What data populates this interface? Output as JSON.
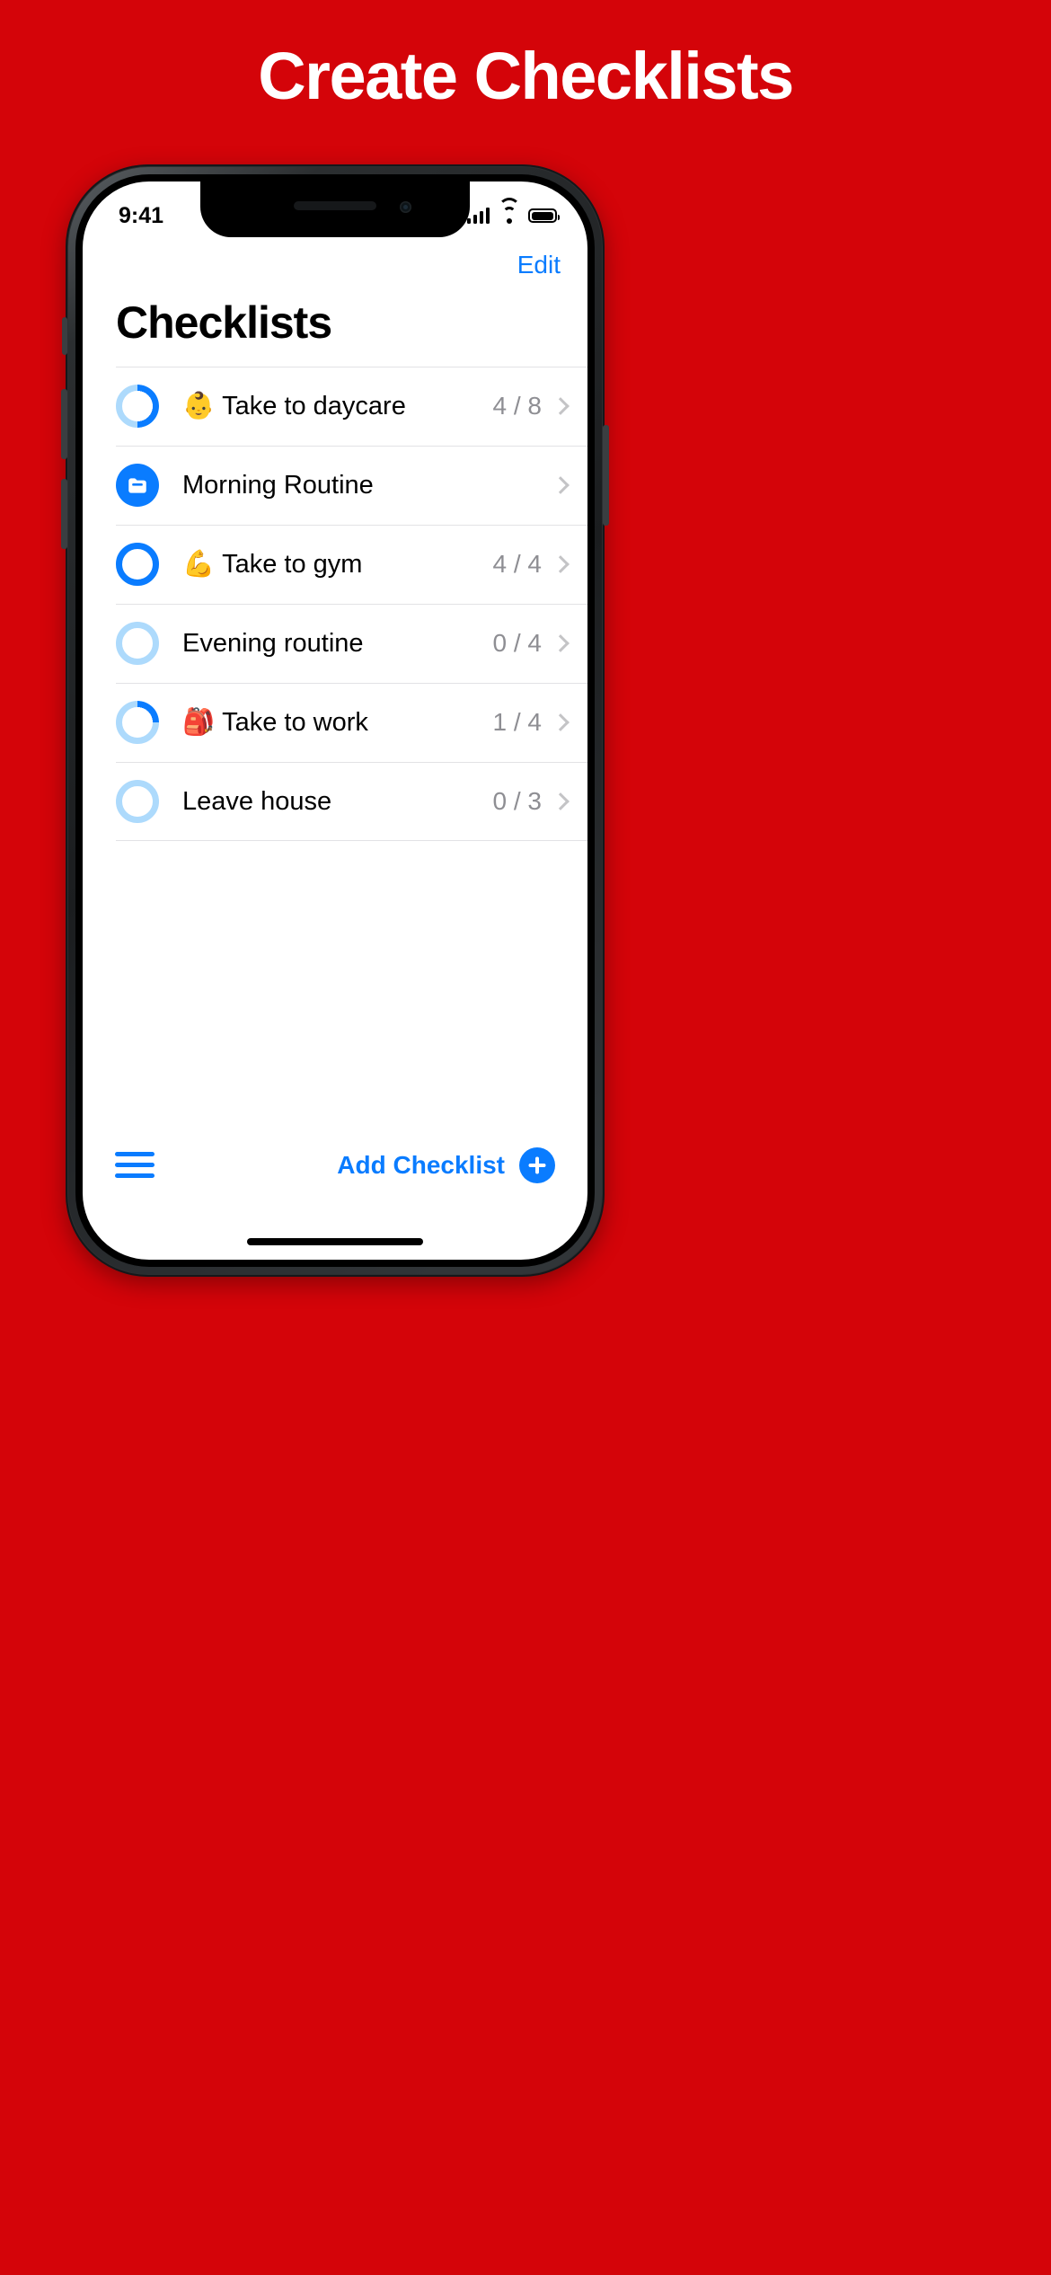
{
  "marketing": {
    "headline": "Create Checklists",
    "background_color": "#D40409"
  },
  "status_bar": {
    "time": "9:41",
    "signal_icon": "cellular-signal-icon",
    "wifi_icon": "wifi-icon",
    "battery_icon": "battery-icon"
  },
  "nav": {
    "edit_label": "Edit"
  },
  "page_title": "Checklists",
  "accent_color": "#0A7CFF",
  "ring_track_color": "#ADDAFC",
  "rows": [
    {
      "icon_type": "progress-ring",
      "emoji": "👶",
      "label": "Take to daycare",
      "count": "4 / 8",
      "done": 4,
      "total": 8,
      "chevron": "chevron-right-icon"
    },
    {
      "icon_type": "folder",
      "emoji": "",
      "label": "Morning Routine",
      "count": "",
      "done": null,
      "total": null,
      "chevron": "chevron-right-icon"
    },
    {
      "icon_type": "progress-ring",
      "emoji": "💪",
      "label": "Take to gym",
      "count": "4 / 4",
      "done": 4,
      "total": 4,
      "chevron": "chevron-right-icon"
    },
    {
      "icon_type": "progress-ring",
      "emoji": "",
      "label": "Evening routine",
      "count": "0 / 4",
      "done": 0,
      "total": 4,
      "chevron": "chevron-right-icon"
    },
    {
      "icon_type": "progress-ring",
      "emoji": "🎒",
      "label": "Take to work",
      "count": "1 / 4",
      "done": 1,
      "total": 4,
      "chevron": "chevron-right-icon"
    },
    {
      "icon_type": "progress-ring",
      "emoji": "",
      "label": "Leave house",
      "count": "0 / 3",
      "done": 0,
      "total": 3,
      "chevron": "chevron-right-icon"
    }
  ],
  "toolbar": {
    "menu_icon": "hamburger-menu-icon",
    "add_label": "Add Checklist",
    "add_icon": "plus-circle-icon"
  }
}
